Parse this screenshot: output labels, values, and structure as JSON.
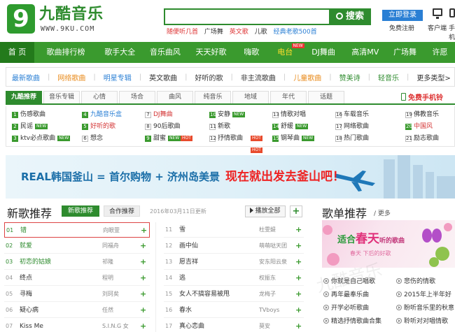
{
  "brand": {
    "logo_char": "9",
    "name": "九酷音乐",
    "url": "WWW.9KU.COM"
  },
  "search": {
    "button": "搜索",
    "hot_tags": [
      "随便听几首",
      "广场舞",
      "英文歌",
      "儿歌",
      "经典老歌500首"
    ]
  },
  "account": {
    "login": "立即登录",
    "register": "免费注册",
    "client": "客户端",
    "mobile": "手机"
  },
  "nav": [
    {
      "label": "首 页",
      "active": true,
      "yellow": false,
      "new": false
    },
    {
      "label": "歌曲排行榜",
      "active": false,
      "yellow": false,
      "new": false
    },
    {
      "label": "歌手大全",
      "active": false,
      "yellow": false,
      "new": false
    },
    {
      "label": "音乐曲风",
      "active": false,
      "yellow": false,
      "new": false
    },
    {
      "label": "天天好歌",
      "active": false,
      "yellow": false,
      "new": false
    },
    {
      "label": "嗨歌",
      "active": false,
      "yellow": false,
      "new": false
    },
    {
      "label": "电台",
      "active": false,
      "yellow": true,
      "new": true
    },
    {
      "label": "DJ舞曲",
      "active": false,
      "yellow": false,
      "new": false
    },
    {
      "label": "高清MV",
      "active": false,
      "yellow": false,
      "new": false
    },
    {
      "label": "广场舞",
      "active": false,
      "yellow": false,
      "new": false
    },
    {
      "label": "许愿",
      "active": false,
      "yellow": false,
      "new": false
    }
  ],
  "genres": [
    {
      "label": "最新歌曲",
      "color": "#2a7fd4"
    },
    {
      "label": "网络歌曲",
      "color": "#e88a1a"
    },
    {
      "label": "明星专辑",
      "color": "#2a7fd4"
    },
    {
      "label": "英文歌曲",
      "color": "#333333"
    },
    {
      "label": "好听的歌",
      "color": "#333333"
    },
    {
      "label": "非主流歌曲",
      "color": "#333333"
    },
    {
      "label": "儿童歌曲",
      "color": "#e88a1a"
    },
    {
      "label": "赞美诗",
      "color": "#2e8b2e"
    },
    {
      "label": "轻音乐",
      "color": "#2e8b2e"
    },
    {
      "label": "更多类型>",
      "color": "#333333"
    }
  ],
  "tabs": [
    "九酷推荐",
    "音乐专辑",
    "心情",
    "场合",
    "曲风",
    "纯音乐",
    "地域",
    "年代",
    "话题"
  ],
  "mobile_download": "免费手机铃",
  "grid": [
    {
      "n": "1",
      "label": "伤感歌曲",
      "badge": "hot",
      "color": "#333333"
    },
    {
      "n": "2",
      "label": "民谣",
      "badge": "new",
      "color": "#333333"
    },
    {
      "n": "3",
      "label": "ktv必点歌曲",
      "badge": "new",
      "color": "#333333"
    },
    {
      "n": "4",
      "label": "九酷音乐盒",
      "badge": "hot",
      "color": "#2a7fd4"
    },
    {
      "n": "5",
      "label": "好听的歌",
      "badge": "hot",
      "color": "#d33333"
    },
    {
      "n": "6",
      "label": "想念",
      "badge": "",
      "color": "#333333"
    },
    {
      "n": "7",
      "label": "DJ舞曲",
      "badge": "",
      "color": "#d33333"
    },
    {
      "n": "8",
      "label": "90后歌曲",
      "badge": "",
      "color": "#333333"
    },
    {
      "n": "9",
      "label": "甜蜜",
      "badge": "new",
      "color": "#333333"
    },
    {
      "n": "10",
      "label": "安静",
      "badge": "new",
      "color": "#333333"
    },
    {
      "n": "11",
      "label": "新歌",
      "badge": "",
      "color": "#333333"
    },
    {
      "n": "12",
      "label": "抒情歌曲",
      "badge": "",
      "color": "#333333"
    },
    {
      "n": "13",
      "label": "情歌对唱",
      "badge": "",
      "color": "#333333"
    },
    {
      "n": "14",
      "label": "舒缓",
      "badge": "new",
      "color": "#333333"
    },
    {
      "n": "15",
      "label": "钢琴曲",
      "badge": "new",
      "color": "#333333"
    },
    {
      "n": "16",
      "label": "车载音乐",
      "badge": "",
      "color": "#333333"
    },
    {
      "n": "17",
      "label": "网络歌曲",
      "badge": "",
      "color": "#333333"
    },
    {
      "n": "18",
      "label": "热门歌曲",
      "badge": "",
      "color": "#333333"
    },
    {
      "n": "19",
      "label": "佛教音乐",
      "badge": "",
      "color": "#333333"
    },
    {
      "n": "20",
      "label": "中国风",
      "badge": "hot",
      "color": "#d33333"
    },
    {
      "n": "21",
      "label": "励志歌曲",
      "badge": "",
      "color": "#333333"
    }
  ],
  "banner": {
    "part1": "REAL韩国釜山 = 首尔购物 + 济州岛美景",
    "part2": "现在就出发去釜山吧！"
  },
  "new_songs": {
    "title": "新歌推荐",
    "tab_active": "新歌推荐",
    "tab_inactive": "合作推荐",
    "date": "2016年03月11日更新",
    "play_all": "播放全部",
    "left": [
      {
        "num": "01",
        "title": "错",
        "artist": "向眼萱",
        "green": true
      },
      {
        "num": "02",
        "title": "就爱",
        "artist": "同福舟",
        "green": true
      },
      {
        "num": "03",
        "title": "初恋的姑娘",
        "artist": "祁隆",
        "green": true
      },
      {
        "num": "04",
        "title": "终点",
        "artist": "程明",
        "green": false
      },
      {
        "num": "05",
        "title": "寻梅",
        "artist": "刘珂矣",
        "green": false
      },
      {
        "num": "06",
        "title": "疑心病",
        "artist": "任然",
        "green": false
      },
      {
        "num": "07",
        "title": "Kiss Me",
        "artist": "S.I.N.G 女",
        "green": false
      }
    ],
    "right": [
      {
        "num": "11",
        "title": "雪",
        "artist": "杜雯媞"
      },
      {
        "num": "12",
        "title": "画中仙",
        "artist": "萌萌哒天团"
      },
      {
        "num": "13",
        "title": "愿吉祥",
        "artist": "安东阳云泉"
      },
      {
        "num": "14",
        "title": "逃",
        "artist": "权振东"
      },
      {
        "num": "15",
        "title": "女人不搞容易被甩",
        "artist": "龙梅子"
      },
      {
        "num": "16",
        "title": "春水",
        "artist": "TVboys"
      },
      {
        "num": "17",
        "title": "真心恋曲",
        "artist": "莫安"
      }
    ]
  },
  "playlists": {
    "title": "歌单推荐",
    "more": "/ 更多",
    "banner_a": "适合",
    "banner_b": "春天",
    "banner_c": "听的歌曲",
    "banner_d": "春天 下后的好歌",
    "items": [
      "你就是自己唱歌",
      "悲伤的情歌",
      "再年最奉乐曲",
      "2015年上半年好",
      "开学必听歌曲",
      "盼听音乐里的秋意",
      "精选抒情歌曲合集",
      "聆听对对唱情歌"
    ]
  }
}
